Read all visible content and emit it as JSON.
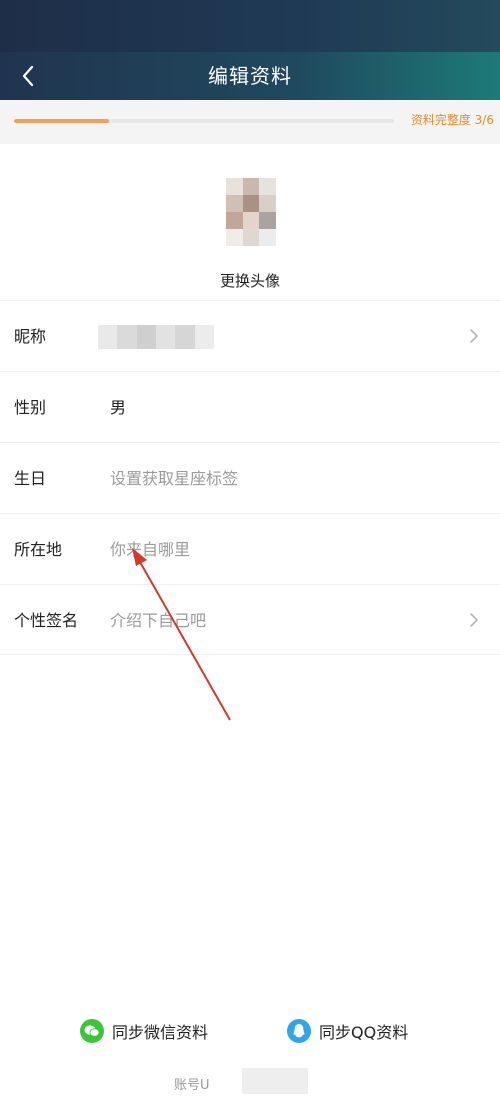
{
  "header": {
    "title": "编辑资料",
    "back_icon": "chevron-left-icon"
  },
  "progress": {
    "label": "资料完整度 3/6",
    "completed": 3,
    "total": 6,
    "accent": "#f2a15d"
  },
  "profile": {
    "change_avatar_label": "更换头像"
  },
  "rows": [
    {
      "label": "昵称",
      "value": "",
      "placeholder": false
    },
    {
      "label": "性别",
      "value": "男",
      "placeholder": false
    },
    {
      "label": "生日",
      "value": "设置获取星座标签",
      "placeholder": true
    },
    {
      "label": "所在地",
      "value": "你来自哪里",
      "placeholder": true
    },
    {
      "label": "个性签名",
      "value": "介绍下自己吧",
      "placeholder": true
    }
  ],
  "sync": {
    "wechat_label": "同步微信资料",
    "qq_label": "同步QQ资料",
    "wechat_color": "#3dc43d",
    "qq_color": "#2fa6e8"
  },
  "account": {
    "label": "账号U"
  }
}
